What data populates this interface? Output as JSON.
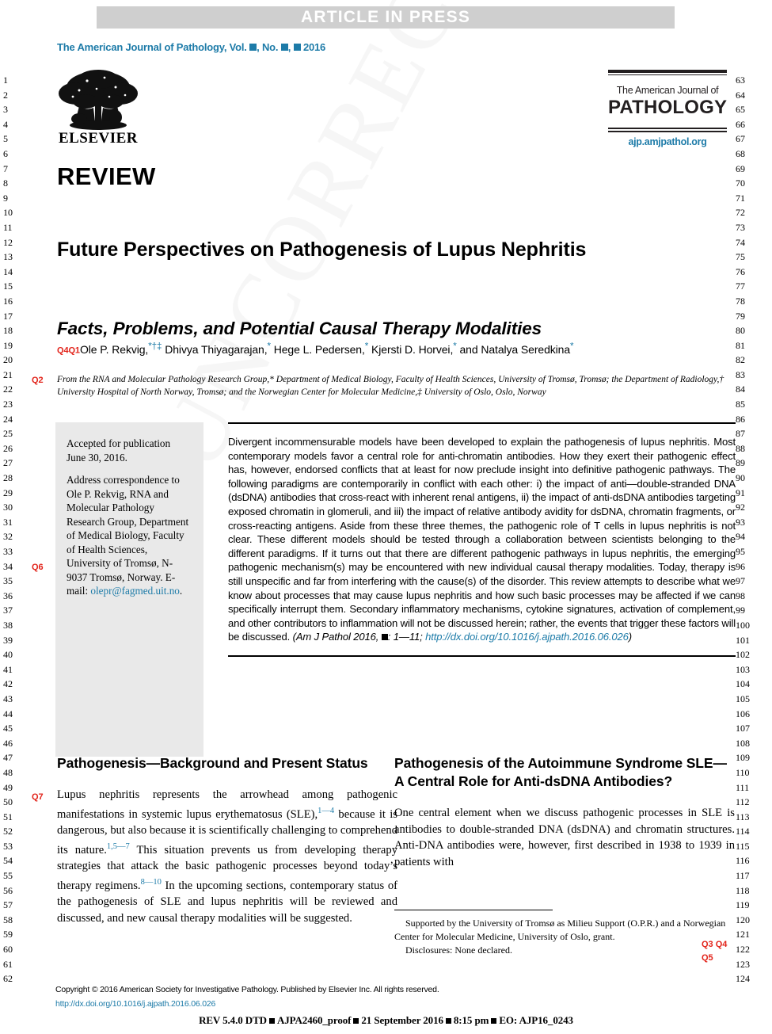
{
  "banner": {
    "label": "ARTICLE IN PRESS"
  },
  "running_head": {
    "prefix": "The American Journal of Pathology, Vol. ",
    "mid1": ", No. ",
    "mid2": ", ",
    "year": " 2016"
  },
  "publisher_logo": {
    "wordmark": "ELSEVIER",
    "alt": "elsevier-tree-logo"
  },
  "masthead": {
    "line1": "The American Journal of",
    "line2": "PATHOLOGY",
    "url": "ajp.amjpathol.org"
  },
  "article": {
    "type_label": "REVIEW",
    "title": "Future Perspectives on Pathogenesis of Lupus Nephritis",
    "subtitle": "Facts, Problems, and Potential Causal Therapy Modalities",
    "author_query_tags": "Q4Q1",
    "authors": [
      {
        "name": "Ole P. Rekvig,",
        "marks": "*†‡"
      },
      {
        "name": "Dhivya Thiyagarajan,",
        "marks": "*"
      },
      {
        "name": "Hege L. Pedersen,",
        "marks": "*"
      },
      {
        "name": "Kjersti D. Horvei,",
        "marks": "*"
      },
      {
        "name": "and Natalya Seredkina",
        "marks": "*"
      }
    ],
    "affiliation_query_tag": "Q2",
    "affiliation": "From the RNA and Molecular Pathology Research Group,* Department of Medical Biology, Faculty of Health Sciences, University of Tromsø, Tromsø; the Department of Radiology,† University Hospital of North Norway, Tromsø; and the Norwegian Center for Molecular Medicine,‡ University of Oslo, Oslo, Norway"
  },
  "infobox": {
    "accepted": "Accepted for publication June 30, 2016.",
    "correspondence_query_tag": "Q6",
    "correspondence_pre": "Address correspondence to Ole P. Rekvig, RNA and Molecular Pathology Research Group, Department of Medical Biology, Faculty of Health Sciences, University of Tromsø, N-9037 Tromsø, Norway. E-mail: ",
    "email": "olepr@fagmed.uit.no",
    "correspondence_post": "."
  },
  "abstract": {
    "text": "Divergent incommensurable models have been developed to explain the pathogenesis of lupus nephritis. Most contemporary models favor a central role for anti-chromatin antibodies. How they exert their pathogenic effect has, however, endorsed conflicts that at least for now preclude insight into definitive pathogenic pathways. The following paradigms are contemporarily in conflict with each other: i) the impact of anti—double-stranded DNA (dsDNA) antibodies that cross-react with inherent renal antigens, ii) the impact of anti-dsDNA antibodies targeting exposed chromatin in glomeruli, and iii) the impact of relative antibody avidity for dsDNA, chromatin fragments, or cross-reacting antigens. Aside from these three themes, the pathogenic role of T cells in lupus nephritis is not clear. These different models should be tested through a collaboration between scientists belonging to the different paradigms. If it turns out that there are different pathogenic pathways in lupus nephritis, the emerging pathogenic mechanism(s) may be encountered with new individual causal therapy modalities. Today, therapy is still unspecific and far from interfering with the cause(s) of the disorder. This review attempts to describe what we know about processes that may cause lupus nephritis and how such basic processes may be affected if we can specifically interrupt them. Secondary inflammatory mechanisms, cytokine signatures, activation of complement, and other contributors to inflammation will not be discussed herein; rather, the events that trigger these factors will be discussed. ",
    "citation_pre": "(Am J Pathol  2016, ",
    "citation_post": ": 1—11; ",
    "doi": "http://dx.doi.org/10.1016/j.ajpath.2016.06.026",
    "citation_close": ")"
  },
  "columns": {
    "left": {
      "heading": "Pathogenesis—Background and Present Status",
      "query_tag": "Q7",
      "paragraph_1": "Lupus nephritis represents the arrowhead among pathogenic manifestations in systemic lupus erythematosus (SLE),",
      "ref_1": "1—4",
      "paragraph_2": " because it is dangerous, but also because it is scientifically challenging to comprehend its nature.",
      "ref_2": "1,5—7",
      "paragraph_3": " This situation prevents us from developing therapy strategies that attack the basic pathogenic processes beyond today’s therapy regimens.",
      "ref_3": "8—10",
      "paragraph_4": " In the upcoming sections, contemporary status of the pathogenesis of SLE and lupus nephritis will be reviewed and discussed, and new causal therapy modalities will be suggested."
    },
    "right": {
      "heading": "Pathogenesis of the Autoimmune Syndrome SLE—A Central Role for Anti-dsDNA Antibodies?",
      "paragraph_1": "One central element when we discuss pathogenic processes in SLE is antibodies to double-stranded DNA (dsDNA) and chromatin structures. Anti-DNA antibodies were, however, first described in 1938 to 1939 in patients with"
    }
  },
  "footnote": {
    "support": "Supported by the University of Tromsø as Milieu Support (O.P.R.) and a Norwegian Center for Molecular Medicine, University of Oslo, grant.",
    "disclosures": "Disclosures: None declared.",
    "query_tags_line1": "Q3 Q4",
    "query_tags_line2": "Q5"
  },
  "footer": {
    "copyright": "Copyright © 2016 American Society for Investigative Pathology. Published by Elsevier Inc. All rights reserved.",
    "doi": "http://dx.doi.org/10.1016/j.ajpath.2016.06.026",
    "dtd_parts": [
      "REV 5.4.0 DTD",
      "AJPA2460_proof",
      "21 September 2016",
      "8:15 pm",
      "EO: AJP16_0243"
    ]
  },
  "line_numbers": {
    "left_start": 1,
    "left_end": 62,
    "right_start": 63,
    "right_end": 124
  },
  "watermark": {
    "text": "UNCORRECTED PROOF"
  },
  "colors": {
    "accent_blue": "#1d7ba8",
    "query_red": "#e2231a",
    "banner_gray": "#cfcfcf",
    "infobox_gray": "#e9e9e9"
  }
}
